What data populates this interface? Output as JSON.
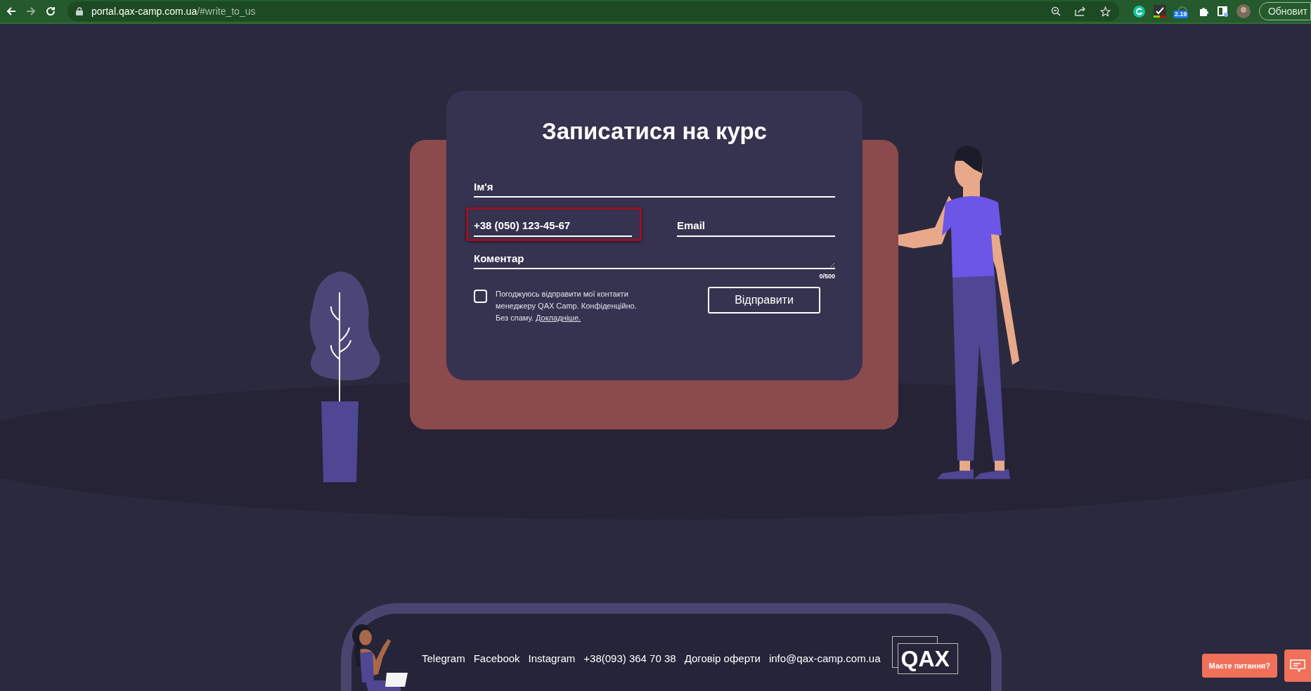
{
  "browser": {
    "url_host": "portal.qax-camp.com.ua",
    "url_path": "/#write_to_us",
    "extension_badge": "2.19",
    "update_button": "Обновит"
  },
  "form": {
    "title": "Записатися на курс",
    "fields": [
      {
        "kind": "input",
        "placeholder": "Ім'я",
        "highlighted": false
      },
      {
        "kind": "input",
        "value": "+38 (050) 123-45-67",
        "highlighted": true
      },
      {
        "kind": "input",
        "placeholder": "Email",
        "highlighted": false
      },
      {
        "kind": "textarea",
        "placeholder": "Коментар",
        "counter": "0/500",
        "highlighted": false
      }
    ],
    "consent": {
      "checked": false,
      "text": "Погоджуюсь відправити мої контакти менеджеру QAX Camp. Конфіденційно. Без спаму.",
      "link": "Докладніше."
    },
    "submit": "Відправити"
  },
  "footer": {
    "links": [
      "Telegram",
      "Facebook",
      "Instagram",
      "+38(093) 364 70 38",
      "Договір оферти",
      "info@qax-camp.com.ua"
    ],
    "logo": "QAX"
  },
  "chat": {
    "label": "Маєте питання?"
  }
}
